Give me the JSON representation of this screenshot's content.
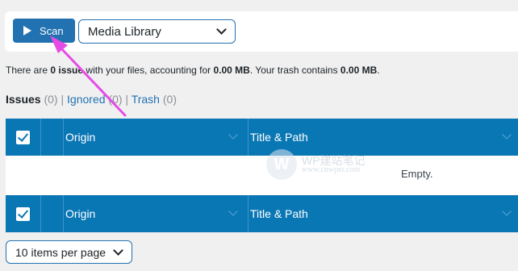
{
  "toolbar": {
    "scan_label": "Scan",
    "source_select": "Media Library"
  },
  "summary": {
    "prefix": "There are ",
    "issue_count": "0 issue",
    "middle": " with your files, accounting for ",
    "size": "0.00 MB",
    "trash_prefix": ". Your trash contains ",
    "trash_size": "0.00 MB",
    "suffix": "."
  },
  "filters": {
    "issues_label": "Issues",
    "issues_count": "(0)",
    "ignored_label": "Ignored",
    "ignored_count": "(0)",
    "trash_label": "Trash",
    "trash_count": "(0)",
    "separator": "|"
  },
  "table": {
    "columns": [
      "Origin",
      "Title & Path"
    ],
    "empty_text": "Empty."
  },
  "watermark": {
    "logo": "W",
    "title": "WP建站笔记",
    "subtitle": "www.cnwper.com"
  },
  "pagination": {
    "per_page": "10 items per page"
  },
  "colors": {
    "accent": "#2271b1",
    "header_bg": "#0a77b5",
    "annotation_arrow": "#e64be6"
  }
}
